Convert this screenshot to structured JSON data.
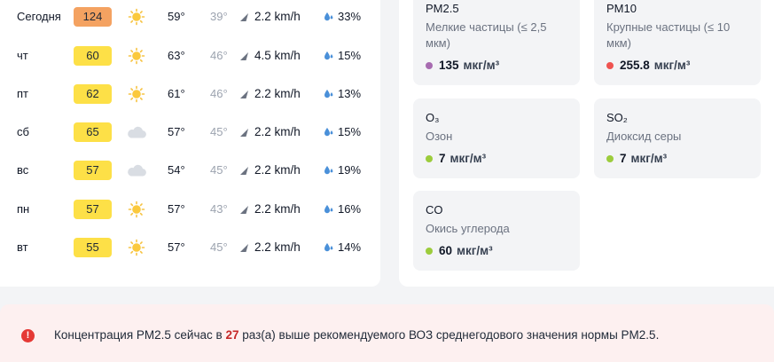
{
  "forecast": [
    {
      "day": "Сегодня",
      "aqi": "124",
      "aqi_color": "#f4a261",
      "weather_icon": "sun-icon",
      "high": "59°",
      "low": "39°",
      "wind": "2.2 km/h",
      "humidity": "33%"
    },
    {
      "day": "чт",
      "aqi": "60",
      "aqi_color": "#fde047",
      "weather_icon": "sun-icon",
      "high": "63°",
      "low": "46°",
      "wind": "4.5 km/h",
      "humidity": "15%"
    },
    {
      "day": "пт",
      "aqi": "62",
      "aqi_color": "#fde047",
      "weather_icon": "sun-icon",
      "high": "61°",
      "low": "46°",
      "wind": "2.2 km/h",
      "humidity": "13%"
    },
    {
      "day": "сб",
      "aqi": "65",
      "aqi_color": "#fde047",
      "weather_icon": "cloud-icon",
      "high": "57°",
      "low": "45°",
      "wind": "2.2 km/h",
      "humidity": "15%"
    },
    {
      "day": "вс",
      "aqi": "57",
      "aqi_color": "#fde047",
      "weather_icon": "cloud-icon",
      "high": "54°",
      "low": "45°",
      "wind": "2.2 km/h",
      "humidity": "19%"
    },
    {
      "day": "пн",
      "aqi": "57",
      "aqi_color": "#fde047",
      "weather_icon": "sun-icon",
      "high": "57°",
      "low": "43°",
      "wind": "2.2 km/h",
      "humidity": "16%"
    },
    {
      "day": "вт",
      "aqi": "55",
      "aqi_color": "#fde047",
      "weather_icon": "sun-icon",
      "high": "57°",
      "low": "45°",
      "wind": "2.2 km/h",
      "humidity": "14%"
    }
  ],
  "pollutants": {
    "pm25": {
      "name": "PM2.5",
      "desc_line1": "Мелкие частицы (≤ 2,5",
      "desc_line2": "мкм)",
      "value": "135",
      "unit": "мкг/м³",
      "color": "#a76bb0"
    },
    "pm10": {
      "name": "PM10",
      "desc_line1": "Крупные частицы (≤ 10",
      "desc_line2": "мкм)",
      "value": "255.8",
      "unit": "мкг/м³",
      "color": "#ef5350"
    },
    "o3": {
      "name": "O₃",
      "desc": "Озон",
      "value": "7",
      "unit": "мкг/м³",
      "color": "#9ccc3c"
    },
    "so2": {
      "name": "SO₂",
      "desc": "Диоксид серы",
      "value": "7",
      "unit": "мкг/м³",
      "color": "#9ccc3c"
    },
    "co": {
      "name": "CO",
      "desc": "Окись углерода",
      "value": "60",
      "unit": "мкг/м³",
      "color": "#9ccc3c"
    }
  },
  "alert": {
    "icon": "alert-icon",
    "prefix": "Концентрация PM2.5 сейчас в ",
    "multiplier": "27",
    "suffix": " раз(а) выше рекомендуемого ВОЗ среднегодового значения нормы PM2.5."
  }
}
